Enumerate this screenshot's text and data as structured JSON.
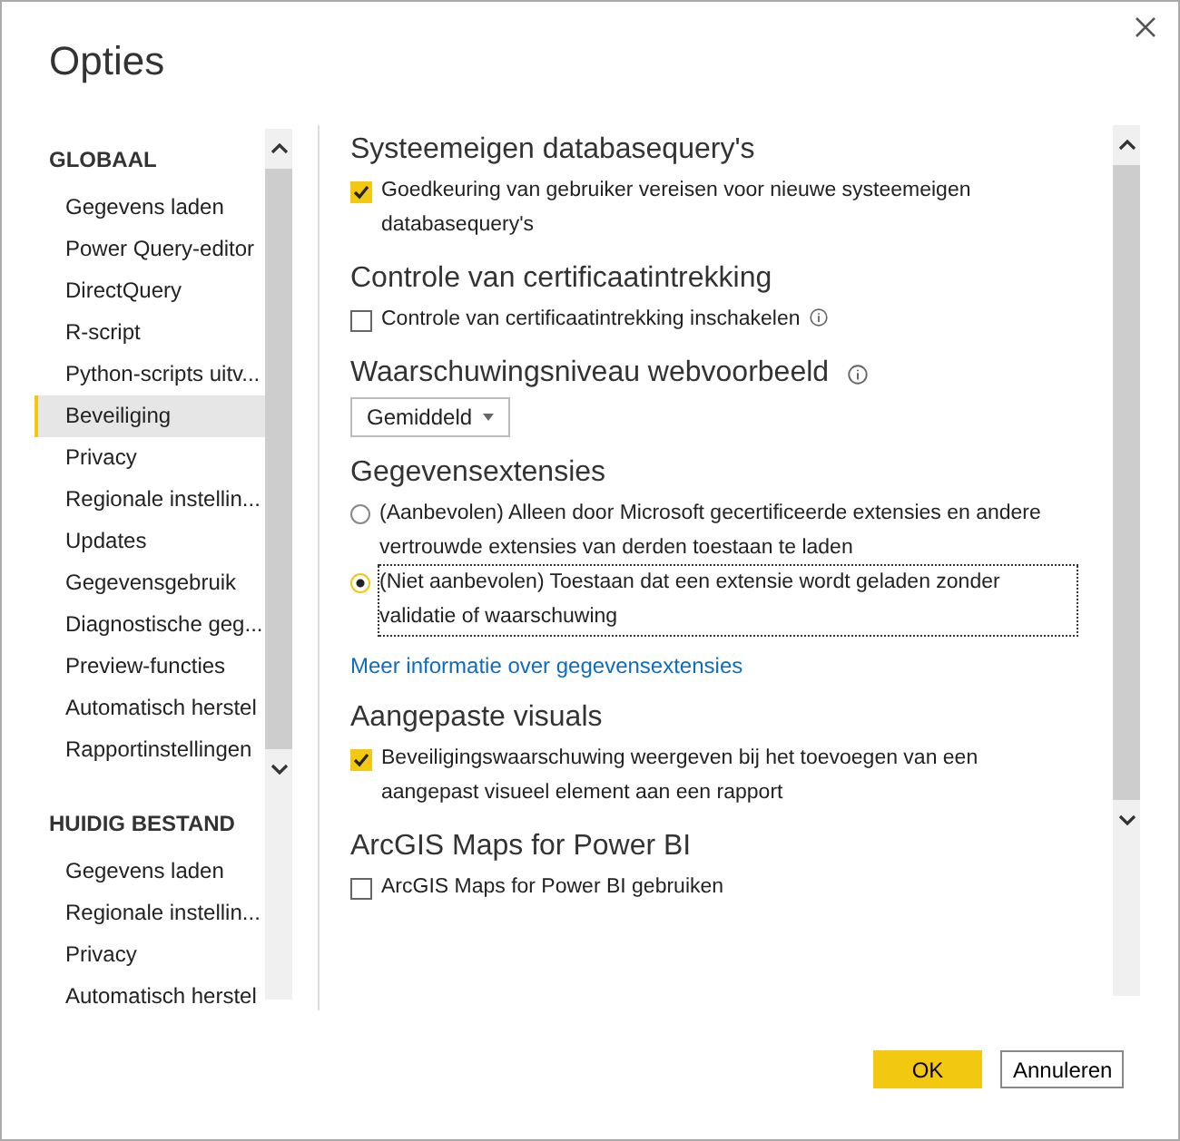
{
  "window": {
    "title": "Opties"
  },
  "sidebar": {
    "sections": [
      {
        "heading": "GLOBAAL",
        "items": [
          {
            "label": "Gegevens laden",
            "selected": false
          },
          {
            "label": "Power Query-editor",
            "selected": false
          },
          {
            "label": "DirectQuery",
            "selected": false
          },
          {
            "label": "R-script",
            "selected": false
          },
          {
            "label": "Python-scripts uitv...",
            "selected": false
          },
          {
            "label": "Beveiliging",
            "selected": true
          },
          {
            "label": "Privacy",
            "selected": false
          },
          {
            "label": "Regionale instellin...",
            "selected": false
          },
          {
            "label": "Updates",
            "selected": false
          },
          {
            "label": "Gegevensgebruik",
            "selected": false
          },
          {
            "label": "Diagnostische geg...",
            "selected": false
          },
          {
            "label": "Preview-functies",
            "selected": false
          },
          {
            "label": "Automatisch herstel",
            "selected": false
          },
          {
            "label": "Rapportinstellingen",
            "selected": false
          }
        ]
      },
      {
        "heading": "HUIDIG BESTAND",
        "items": [
          {
            "label": "Gegevens laden",
            "selected": false
          },
          {
            "label": "Regionale instellin...",
            "selected": false
          },
          {
            "label": "Privacy",
            "selected": false
          },
          {
            "label": "Automatisch herstel",
            "selected": false
          }
        ]
      }
    ]
  },
  "content": {
    "sections": [
      {
        "heading": "Systeemeigen databasequery's",
        "info": false,
        "controls": [
          {
            "kind": "checkbox",
            "label": "Goedkeuring van gebruiker vereisen voor nieuwe systeemeigen databasequery's",
            "checked": true,
            "info": false
          }
        ]
      },
      {
        "heading": "Controle van certificaatintrekking",
        "info": false,
        "controls": [
          {
            "kind": "checkbox",
            "label": "Controle van certificaatintrekking inschakelen",
            "checked": false,
            "info": true
          }
        ]
      },
      {
        "heading": "Waarschuwingsniveau webvoorbeeld",
        "info": true,
        "controls": [
          {
            "kind": "dropdown",
            "value": "Gemiddeld"
          }
        ]
      },
      {
        "heading": "Gegevensextensies",
        "info": false,
        "controls": [
          {
            "kind": "radio",
            "label": "(Aanbevolen) Alleen door Microsoft gecertificeerde extensies en andere vertrouwde extensies van derden toestaan te laden",
            "selected": false,
            "focused": false
          },
          {
            "kind": "radio",
            "label": "(Niet aanbevolen) Toestaan dat een extensie wordt geladen zonder validatie of waarschuwing",
            "selected": true,
            "focused": true
          },
          {
            "kind": "link",
            "label": "Meer informatie over gegevensextensies"
          }
        ]
      },
      {
        "heading": "Aangepaste visuals",
        "info": false,
        "controls": [
          {
            "kind": "checkbox",
            "label": "Beveiligingswaarschuwing weergeven bij het toevoegen van een aangepast visueel element aan een rapport",
            "checked": true,
            "info": false
          }
        ]
      },
      {
        "heading": "ArcGIS Maps for Power BI",
        "info": false,
        "controls": [
          {
            "kind": "checkbox",
            "label": "ArcGIS Maps for Power BI gebruiken",
            "checked": false,
            "info": false
          }
        ]
      }
    ]
  },
  "buttons": [
    {
      "label": "OK",
      "kind": "primary"
    },
    {
      "label": "Annuleren",
      "kind": "secondary"
    }
  ]
}
